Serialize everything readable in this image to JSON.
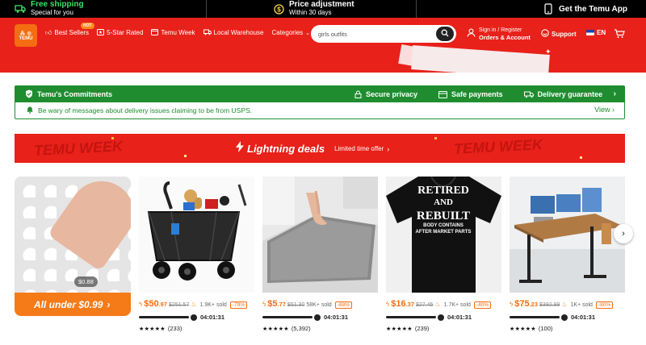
{
  "topbar": {
    "free_shipping_title": "Free shipping",
    "free_shipping_sub": "Special for you",
    "price_adj_title": "Price adjustment",
    "price_adj_sub": "Within 30 days",
    "get_app": "Get the Temu App"
  },
  "header": {
    "logo_text": "TEMU",
    "nav": [
      {
        "label": "Best Sellers",
        "badge": "HOT",
        "icon": "thumbs-up-icon"
      },
      {
        "label": "5-Star Rated",
        "icon": "star-rated-icon"
      },
      {
        "label": "Temu Week",
        "icon": "calendar-icon"
      },
      {
        "label": "Local Warehouse",
        "icon": "truck-icon"
      },
      {
        "label": "Categories",
        "icon": "chevron-down-icon"
      }
    ],
    "search_value": "girls outfits",
    "account_small": "Sign in / Register",
    "account_bold": "Orders & Account",
    "support": "Support",
    "language": "EN"
  },
  "commitments": {
    "title": "Temu's Commitments",
    "items": [
      "Secure privacy",
      "Safe payments",
      "Delivery guarantee"
    ],
    "warning": "Be wary of messages about delivery issues claiming to be from USPS.",
    "view": "View"
  },
  "banner": {
    "title": "Lightning deals",
    "subtitle": "Limited time offer",
    "watermark": "TEMU WEEK"
  },
  "first_tile": {
    "chip_price": "$0.88",
    "label": "All under $0.99"
  },
  "products": [
    {
      "price_main": "$50",
      "price_cents": ".97",
      "old_price": "$251.57",
      "sold": "1.9K+ sold",
      "discount": "-79%",
      "timer": "04:01:31",
      "stars": "★★★★★",
      "reviews": "(233)"
    },
    {
      "price_main": "$5",
      "price_cents": ".77",
      "old_price": "$51.30",
      "sold": "58K+ sold",
      "discount": "-88%",
      "timer": "04:01:31",
      "stars": "★★★★★",
      "reviews": "(5,392)"
    },
    {
      "price_main": "$16",
      "price_cents": ".37",
      "old_price": "$27.45",
      "sold": "1.7K+ sold",
      "discount": "-40%",
      "timer": "04:01:31",
      "stars": "★★★★★",
      "reviews": "(239)"
    },
    {
      "price_main": "$75",
      "price_cents": ".23",
      "old_price": "$392.99",
      "sold": "1K+ sold",
      "discount": "-80%",
      "timer": "04:01:31",
      "stars": "★★★★★",
      "reviews": "(100)"
    }
  ],
  "tshirt_text": [
    "RETIRED",
    "AND",
    "REBUILT",
    "BODY CONTAINS",
    "AFTER MARKET PARTS"
  ],
  "colors": {
    "accent": "#e8211a",
    "orange": "#f56d12",
    "green": "#1f8d2f",
    "black": "#000000"
  }
}
